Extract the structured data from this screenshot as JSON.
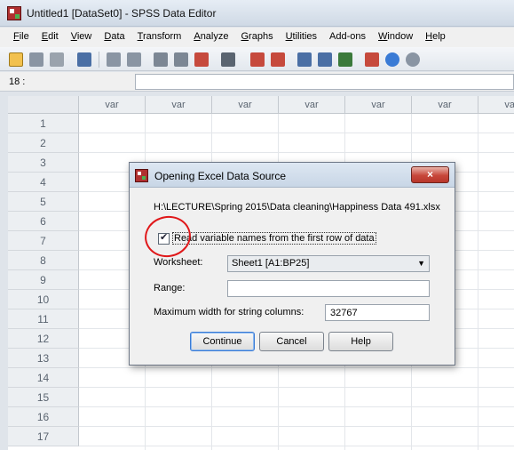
{
  "window": {
    "title": "Untitled1 [DataSet0] - SPSS Data Editor"
  },
  "menu": [
    {
      "u": "F",
      "rest": "ile"
    },
    {
      "u": "E",
      "rest": "dit"
    },
    {
      "u": "V",
      "rest": "iew"
    },
    {
      "u": "D",
      "rest": "ata"
    },
    {
      "u": "T",
      "rest": "ransform"
    },
    {
      "u": "A",
      "rest": "nalyze"
    },
    {
      "u": "G",
      "rest": "raphs"
    },
    {
      "u": "U",
      "rest": "tilities"
    },
    {
      "u": "",
      "rest": "Add-ons"
    },
    {
      "u": "W",
      "rest": "indow"
    },
    {
      "u": "H",
      "rest": "elp"
    }
  ],
  "cell_ref": {
    "label": "18 :"
  },
  "grid": {
    "column_header": "var",
    "rows": [
      "1",
      "2",
      "3",
      "4",
      "5",
      "6",
      "7",
      "8",
      "9",
      "10",
      "11",
      "12",
      "13",
      "14",
      "15",
      "16",
      "17"
    ]
  },
  "dialog": {
    "title": "Opening Excel Data Source",
    "close_label": "×",
    "path": "H:\\LECTURE\\Spring 2015\\Data cleaning\\Happiness Data 491.xlsx",
    "checkbox_label": "Read variable names from the first row of data",
    "checkbox_mark": "✔",
    "worksheet_label": "Worksheet:",
    "worksheet_value": "Sheet1 [A1:BP25]",
    "dropdown_arrow": "▼",
    "range_label": "Range:",
    "range_value": "",
    "maxwidth_label": "Maximum width for string columns:",
    "maxwidth_value": "32767",
    "continue_label": "Continue",
    "cancel_label": "Cancel",
    "help_label": "Help"
  },
  "colors": {
    "annotation_circle": "#e0181a",
    "title_bar": "#cfd9e5",
    "grid_header": "#eceff2"
  }
}
